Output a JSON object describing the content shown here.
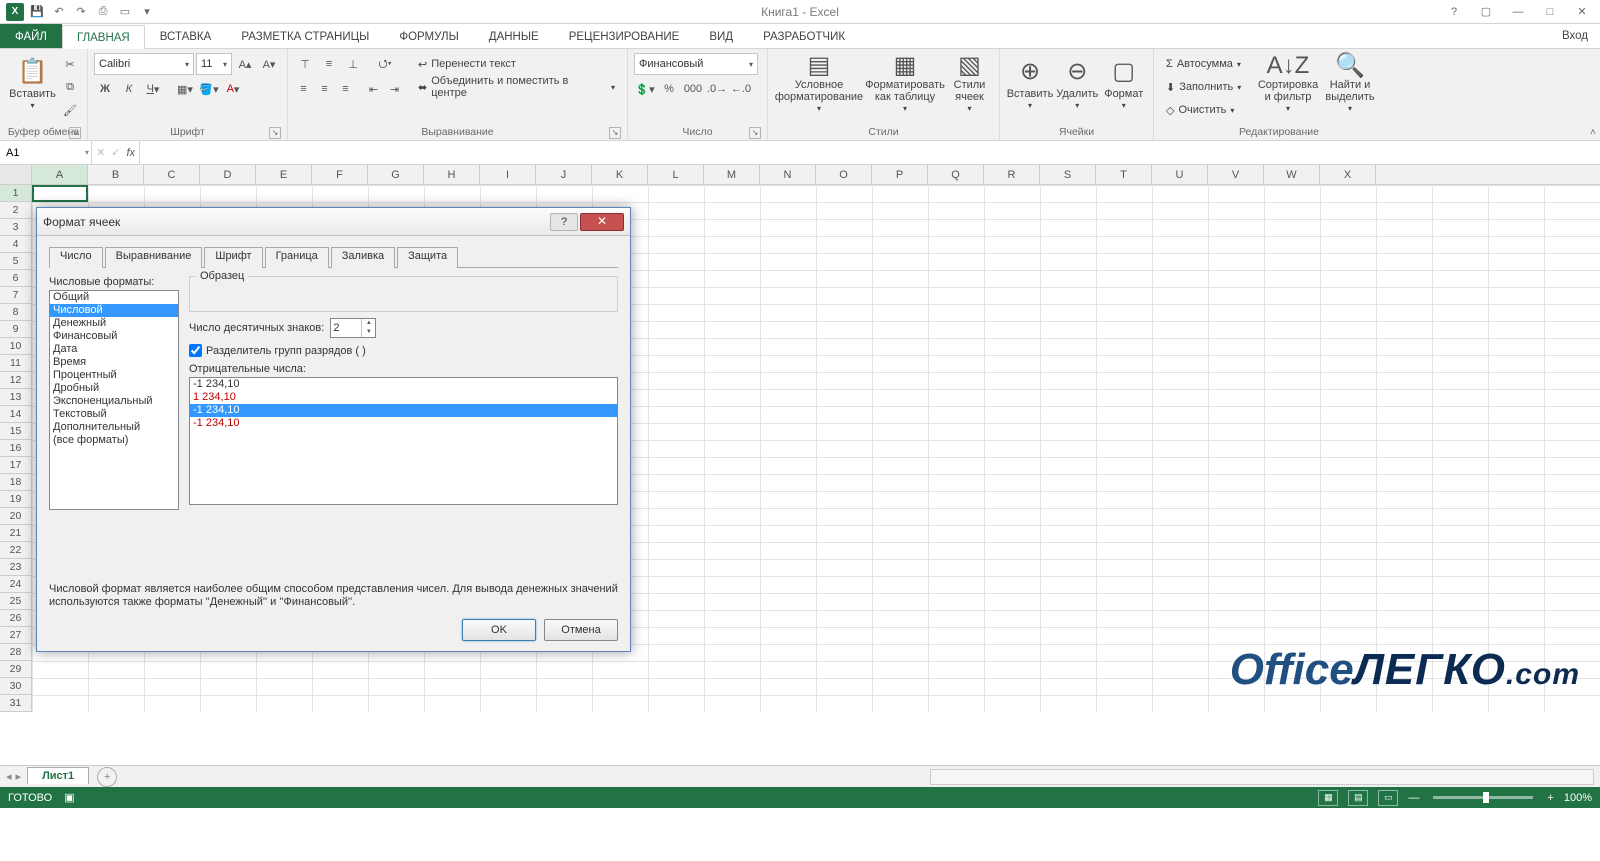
{
  "app": {
    "title": "Книга1 - Excel",
    "signIn": "Вход"
  },
  "tabs": {
    "file": "ФАЙЛ",
    "home": "ГЛАВНАЯ",
    "insert": "ВСТАВКА",
    "pageLayout": "РАЗМЕТКА СТРАНИЦЫ",
    "formulas": "ФОРМУЛЫ",
    "data": "ДАННЫЕ",
    "review": "РЕЦЕНЗИРОВАНИЕ",
    "view": "ВИД",
    "developer": "РАЗРАБОТЧИК"
  },
  "ribbon": {
    "clipboard": {
      "label": "Буфер обмена",
      "paste": "Вставить"
    },
    "font": {
      "label": "Шрифт",
      "name": "Calibri",
      "size": "11"
    },
    "alignment": {
      "label": "Выравнивание",
      "wrap": "Перенести текст",
      "merge": "Объединить и поместить в центре"
    },
    "number": {
      "label": "Число",
      "format": "Финансовый"
    },
    "styles": {
      "label": "Стили",
      "conditional": "Условное форматирование",
      "asTable": "Форматировать как таблицу",
      "cellStyles": "Стили ячеек"
    },
    "cells": {
      "label": "Ячейки",
      "insert": "Вставить",
      "delete": "Удалить",
      "format": "Формат"
    },
    "editing": {
      "label": "Редактирование",
      "autosum": "Автосумма",
      "fill": "Заполнить",
      "clear": "Очистить",
      "sort": "Сортировка и фильтр",
      "find": "Найти и выделить"
    }
  },
  "nameBox": "A1",
  "columns": [
    "A",
    "B",
    "C",
    "D",
    "E",
    "F",
    "G",
    "H",
    "I",
    "J",
    "K",
    "L",
    "M",
    "N",
    "O",
    "P",
    "Q",
    "R",
    "S",
    "T",
    "U",
    "V",
    "W",
    "X"
  ],
  "sheet": {
    "tab": "Лист1"
  },
  "status": {
    "ready": "ГОТОВО",
    "zoom": "100%"
  },
  "dialog": {
    "title": "Формат ячеек",
    "tabs": {
      "number": "Число",
      "alignment": "Выравнивание",
      "font": "Шрифт",
      "border": "Граница",
      "fill": "Заливка",
      "protection": "Защита"
    },
    "catLabel": "Числовые форматы:",
    "categories": [
      "Общий",
      "Числовой",
      "Денежный",
      "Финансовый",
      "Дата",
      "Время",
      "Процентный",
      "Дробный",
      "Экспоненциальный",
      "Текстовый",
      "Дополнительный",
      "(все форматы)"
    ],
    "selectedCategoryIndex": 1,
    "sample": "Образец",
    "decimalsLabel": "Число десятичных знаков:",
    "decimals": "2",
    "thousandsLabel": "Разделитель групп разрядов ( )",
    "negLabel": "Отрицательные числа:",
    "negatives": [
      "-1 234,10",
      "1 234,10",
      "-1 234,10",
      "-1 234,10"
    ],
    "selectedNegIndex": 2,
    "description": "Числовой формат является наиболее общим способом представления чисел. Для вывода денежных значений используются также форматы ''Денежный'' и ''Финансовый''.",
    "ok": "OK",
    "cancel": "Отмена"
  },
  "watermark": {
    "part1": "Office",
    "part2": "ЛЕГКО",
    "part3": ".com"
  }
}
